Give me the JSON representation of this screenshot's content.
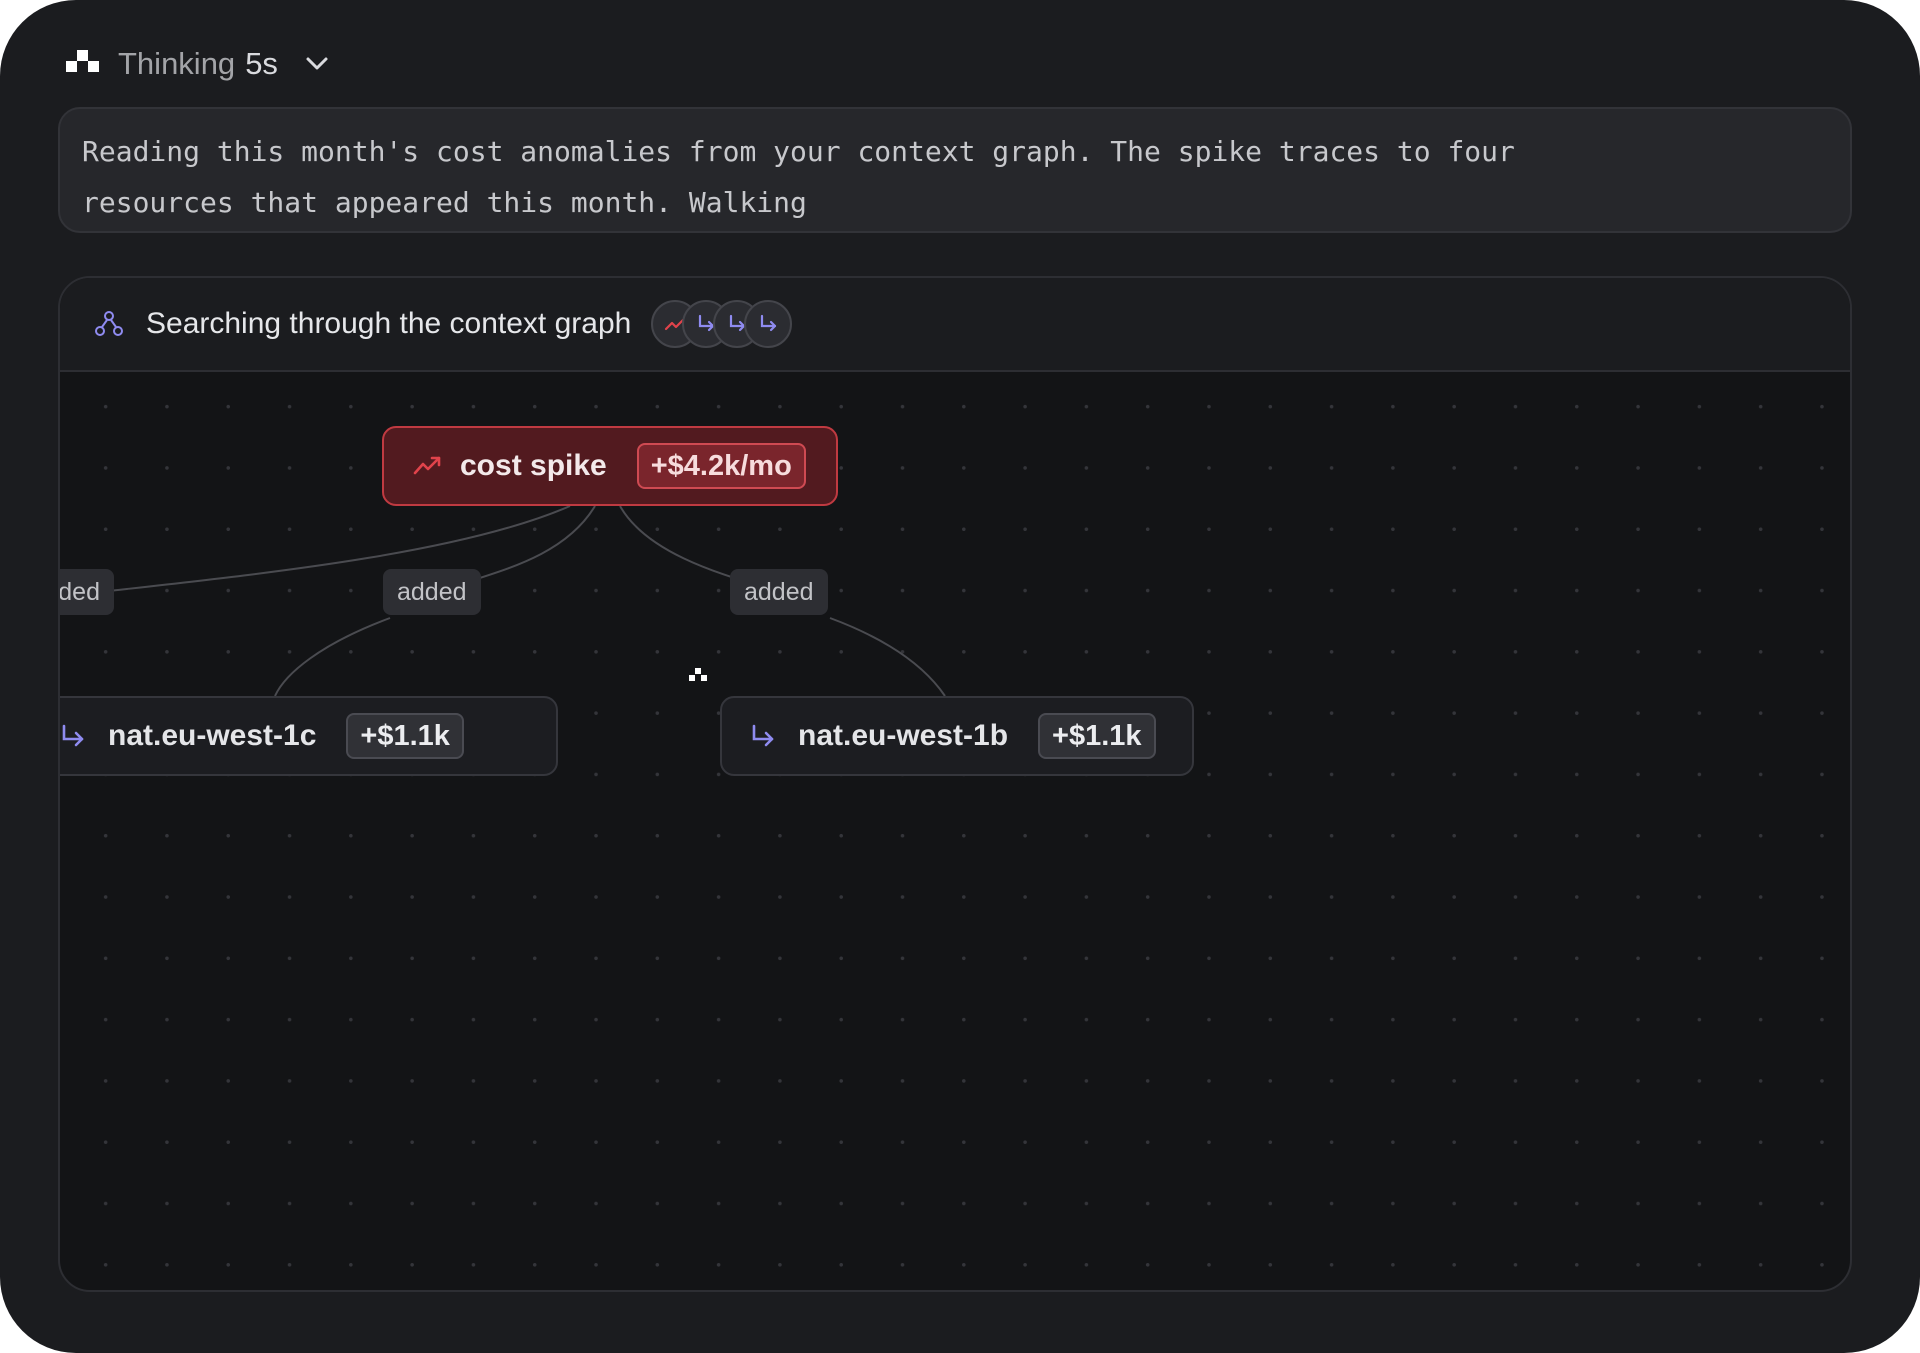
{
  "thinking": {
    "label": "Thinking",
    "duration": "5s",
    "icon": "chevron-down-icon"
  },
  "reasoning": {
    "text": "Reading this month's cost anomalies from your context graph. The spike traces to four\nresources that appeared this month. Walking"
  },
  "panel": {
    "title": "Searching through the context graph",
    "chips": [
      "trending-up-icon",
      "arrow-turn-down-right-icon",
      "arrow-turn-down-right-icon",
      "arrow-turn-down-right-icon"
    ]
  },
  "graph": {
    "root": {
      "label": "cost spike",
      "value": "+$4.2k/mo",
      "icon": "trending-up-icon"
    },
    "edges": [
      {
        "label": "ded"
      },
      {
        "label": "added"
      },
      {
        "label": "added"
      }
    ],
    "nodes": [
      {
        "label": "nat.eu-west-1c",
        "value": "+$1.1k",
        "icon": "arrow-turn-down-right-icon"
      },
      {
        "label": "nat.eu-west-1b",
        "value": "+$1.1k",
        "icon": "arrow-turn-down-right-icon"
      }
    ]
  },
  "colors": {
    "background": "#1b1c1f",
    "canvas": "#131416",
    "spike_fill": "#521a1f",
    "spike_border": "#c03a41",
    "accent_purple": "#8f8bf0",
    "accent_red": "#e0434b"
  }
}
